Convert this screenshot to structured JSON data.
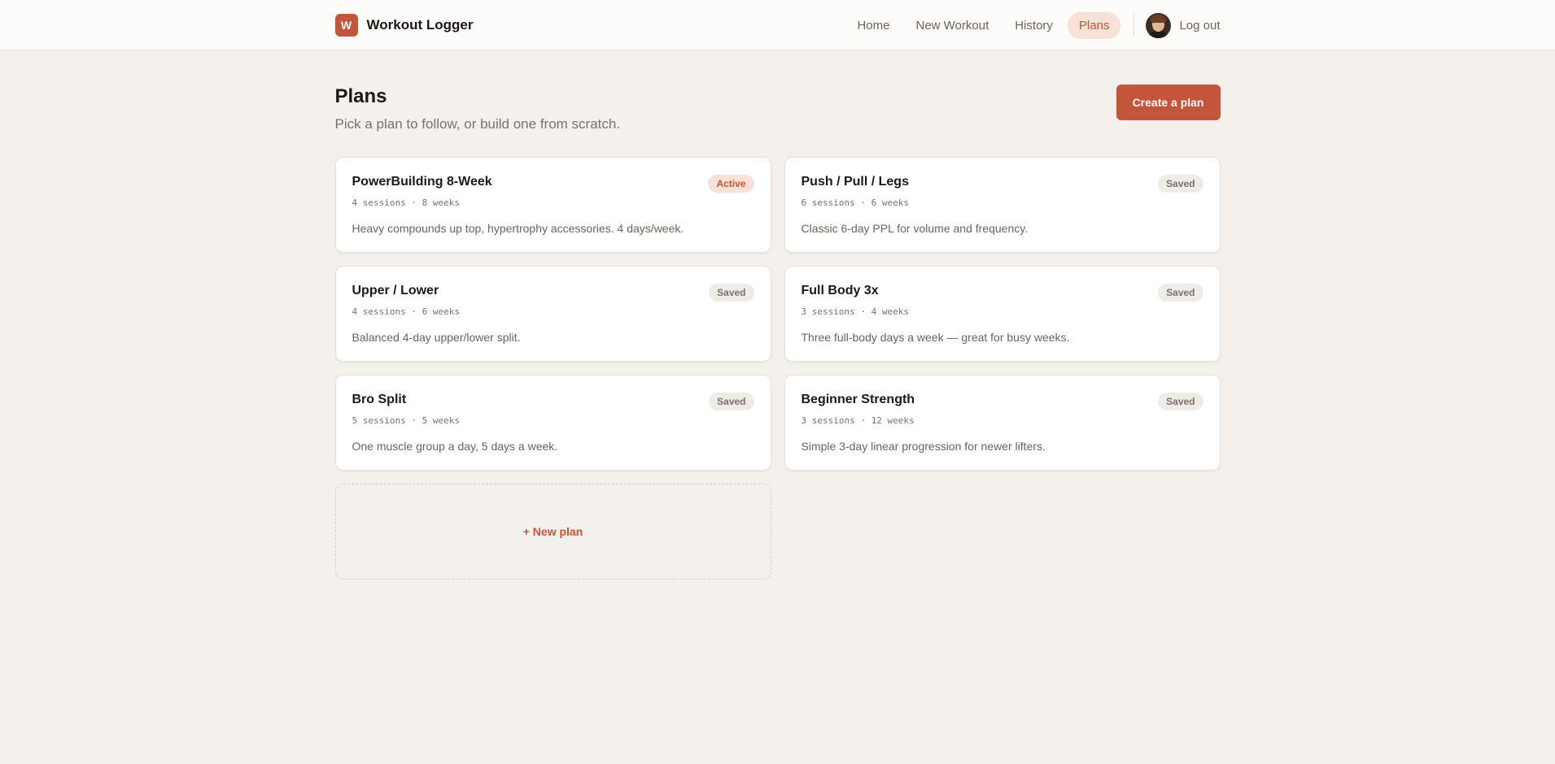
{
  "brand": {
    "logo_letter": "W",
    "name": "Workout Logger"
  },
  "nav": {
    "items": [
      {
        "label": "Home"
      },
      {
        "label": "New Workout"
      },
      {
        "label": "History"
      },
      {
        "label": "Plans"
      }
    ],
    "active": "Plans",
    "logout_label": "Log out"
  },
  "page": {
    "title": "Plans",
    "subtitle": "Pick a plan to follow, or build one from scratch.",
    "create_label": "Create a plan"
  },
  "plans": [
    {
      "name": "PowerBuilding 8-Week",
      "meta": "4 sessions · 8 weeks",
      "description": "Heavy compounds up top, hypertrophy accessories. 4 days/week.",
      "status": "Active"
    },
    {
      "name": "Push / Pull / Legs",
      "meta": "6 sessions · 6 weeks",
      "description": "Classic 6-day PPL for volume and frequency.",
      "status": "Saved"
    },
    {
      "name": "Upper / Lower",
      "meta": "4 sessions · 6 weeks",
      "description": "Balanced 4-day upper/lower split.",
      "status": "Saved"
    },
    {
      "name": "Full Body 3x",
      "meta": "3 sessions · 4 weeks",
      "description": "Three full-body days a week — great for busy weeks.",
      "status": "Saved"
    },
    {
      "name": "Bro Split",
      "meta": "5 sessions · 5 weeks",
      "description": "One muscle group a day, 5 days a week.",
      "status": "Saved"
    },
    {
      "name": "Beginner Strength",
      "meta": "3 sessions · 12 weeks",
      "description": "Simple 3-day linear progression for newer lifters.",
      "status": "Saved"
    }
  ],
  "new_plan_label": "+ New plan",
  "colors": {
    "accent": "#c2553a",
    "accent_soft": "#f8e2d8",
    "background": "#f4f1ed"
  }
}
